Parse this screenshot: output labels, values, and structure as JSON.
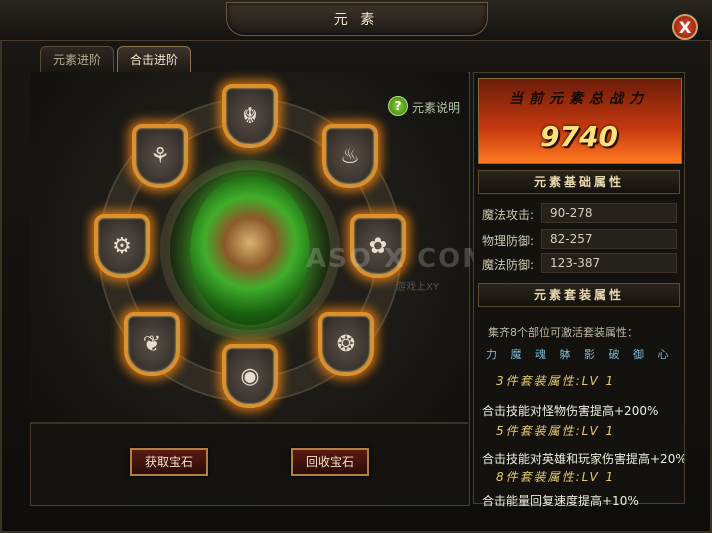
{
  "window": {
    "title": "元 素",
    "close_glyph": "X"
  },
  "tabs": [
    {
      "label": "元素进阶",
      "active": false
    },
    {
      "label": "合击进阶",
      "active": true
    }
  ],
  "help": {
    "label": "元素说明",
    "glyph": "?"
  },
  "gems": [
    "☬",
    "♨",
    "✿",
    "❂",
    "◉",
    "❦",
    "⚙",
    "⚘"
  ],
  "buttons": {
    "take": "获取宝石",
    "recycle": "回收宝石"
  },
  "power": {
    "label": "当前元素总战力",
    "value": "9740"
  },
  "base_attributes": {
    "title": "元素基础属性",
    "stats": [
      {
        "label": "魔法攻击:",
        "value": "90-278"
      },
      {
        "label": "物理防御:",
        "value": "82-257"
      },
      {
        "label": "魔法防御:",
        "value": "123-387"
      }
    ]
  },
  "set_attributes": {
    "title": "元素套装属性",
    "note": "集齐8个部位可激活套装属性：",
    "parts": "力 魔 魂 躰 影 破 御 心",
    "tiers": [
      {
        "label": "3件套装属性:LV 1",
        "bonus": "合击技能对怪物伤害提高+200%"
      },
      {
        "label": "5件套装属性:LV 1",
        "bonus": "合击技能对英雄和玩家伤害提高+20%"
      },
      {
        "label": "8件套装属性:LV 1",
        "bonus": "合击能量回复速度提高+10%"
      }
    ]
  },
  "watermark": {
    "main": "ASO X COM",
    "sub": "游戏上XY"
  },
  "colors": {
    "accent": "#e0902a",
    "core_green": "#3fae2a",
    "power_text": "#ffe27a"
  }
}
